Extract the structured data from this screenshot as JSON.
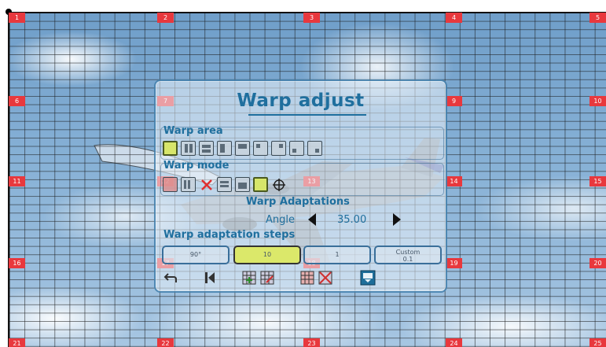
{
  "grid_markers": [
    "1",
    "2",
    "3",
    "4",
    "5",
    "6",
    "7",
    "9",
    "10",
    "11",
    "12",
    "13",
    "14",
    "15",
    "16",
    "17",
    "18",
    "19",
    "20",
    "21",
    "22",
    "23",
    "24",
    "25"
  ],
  "dialog": {
    "title": "Warp adjust",
    "warp_area_label": "Warp area",
    "warp_mode_label": "Warp mode",
    "adaptations_label": "Warp Adaptations",
    "angle_label": "Angle",
    "angle_value": "35.00",
    "steps_label": "Warp adaptation steps",
    "steps": [
      "90°",
      "10",
      "1",
      "Custom\n0.1"
    ],
    "selected_step_index": 1,
    "custom_label": "Custom",
    "custom_value": "0.1"
  },
  "colors": {
    "marker": "#e8383d",
    "accent": "#1f6f9e",
    "selected": "#dbe86a"
  },
  "icons": {
    "warp_area": [
      "area-all-icon",
      "area-left-right-icon",
      "area-top-bottom-icon",
      "area-left-icon",
      "area-top-icon",
      "area-corner-1-icon",
      "area-corner-2-icon",
      "area-corner-3-icon",
      "area-corner-4-icon"
    ],
    "warp_mode": [
      "mode-point-icon",
      "mode-columns-icon",
      "mode-cross-icon",
      "mode-rows-icon",
      "mode-shift-icon",
      "mode-rotate-icon",
      "mode-target-icon"
    ],
    "bottom": [
      "undo-icon",
      "reset-icon",
      "grid-add-icon",
      "grid-edit-icon",
      "grid-clear-icon",
      "grid-delete-icon",
      "save-icon"
    ]
  }
}
